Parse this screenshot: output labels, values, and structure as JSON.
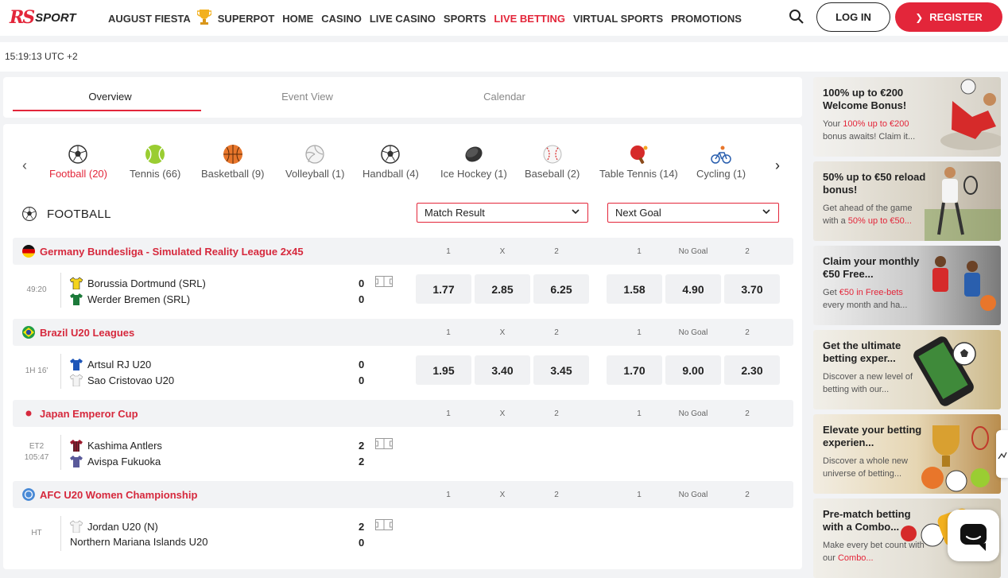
{
  "brand": {
    "logo_rs": "RS",
    "logo_sport": "SPORT",
    "accent": "#e3263a"
  },
  "nav": {
    "items": [
      "AUGUST FIESTA",
      "SUPERPOT",
      "HOME",
      "CASINO",
      "LIVE CASINO",
      "SPORTS",
      "LIVE BETTING",
      "VIRTUAL SPORTS",
      "PROMOTIONS"
    ],
    "login": "LOG IN",
    "register": "REGISTER"
  },
  "clock": "15:19:13 UTC +2",
  "tabs": [
    "Overview",
    "Event View",
    "Calendar"
  ],
  "sports": [
    {
      "label": "Football (20)",
      "icon": "football-icon"
    },
    {
      "label": "Tennis (66)",
      "icon": "tennis-icon"
    },
    {
      "label": "Basketball (9)",
      "icon": "basketball-icon"
    },
    {
      "label": "Volleyball (1)",
      "icon": "volleyball-icon"
    },
    {
      "label": "Handball (4)",
      "icon": "handball-icon"
    },
    {
      "label": "Ice Hockey (1)",
      "icon": "ice-hockey-icon"
    },
    {
      "label": "Baseball (2)",
      "icon": "baseball-icon"
    },
    {
      "label": "Table Tennis (14)",
      "icon": "table-tennis-icon"
    },
    {
      "label": "Cycling (1)",
      "icon": "cycling-icon"
    }
  ],
  "section": {
    "title": "FOOTBALL",
    "market1": "Match Result",
    "market2": "Next Goal"
  },
  "headers": {
    "h1": "1",
    "hx": "X",
    "h2": "2",
    "g1": "1",
    "gno": "No Goal",
    "g2": "2"
  },
  "leagues": [
    {
      "name": "Germany Bundesliga - Simulated Reality League 2x45",
      "time": [
        "49:20"
      ],
      "home": "Borussia Dortmund (SRL)",
      "away": "Werder Bremen (SRL)",
      "home_score": "0",
      "away_score": "0",
      "odds": [
        "1.77",
        "2.85",
        "6.25",
        "1.58",
        "4.90",
        "3.70"
      ]
    },
    {
      "name": "Brazil U20 Leagues",
      "time": [
        "1H 16'"
      ],
      "home": "Artsul RJ U20",
      "away": "Sao Cristovao U20",
      "home_score": "0",
      "away_score": "0",
      "odds": [
        "1.95",
        "3.40",
        "3.45",
        "1.70",
        "9.00",
        "2.30"
      ]
    },
    {
      "name": "Japan Emperor Cup",
      "time": [
        "ET2",
        "105:47"
      ],
      "home": "Kashima Antlers",
      "away": "Avispa Fukuoka",
      "home_score": "2",
      "away_score": "2",
      "odds": []
    },
    {
      "name": "AFC U20 Women Championship",
      "time": [
        "HT"
      ],
      "home": "Jordan U20 (N)",
      "away": "Northern Mariana Islands U20",
      "home_score": "2",
      "away_score": "0",
      "odds": []
    }
  ],
  "promos": [
    {
      "title": "100% up to €200 Welcome Bonus!",
      "desc_pre": "Your ",
      "desc_hl": "100% up to €200",
      "desc_post": " bonus awaits! Claim it..."
    },
    {
      "title": "50% up to €50 reload bonus!",
      "desc_pre": "Get ahead of the game with a ",
      "desc_hl": "50% up to €50...",
      "desc_post": ""
    },
    {
      "title": "Claim your monthly €50 Free...",
      "desc_pre": "Get ",
      "desc_hl": "€50 in Free-bets",
      "desc_post": " every month and ha..."
    },
    {
      "title": "Get the ultimate betting exper...",
      "desc_pre": "Discover a new level of betting with our...",
      "desc_hl": "",
      "desc_post": ""
    },
    {
      "title": "Elevate your betting experien...",
      "desc_pre": "Discover a whole new universe of betting...",
      "desc_hl": "",
      "desc_post": ""
    },
    {
      "title": "Pre-match betting with a Combo...",
      "desc_pre": "Make every bet count with our ",
      "desc_hl": "Combo...",
      "desc_post": ""
    }
  ]
}
